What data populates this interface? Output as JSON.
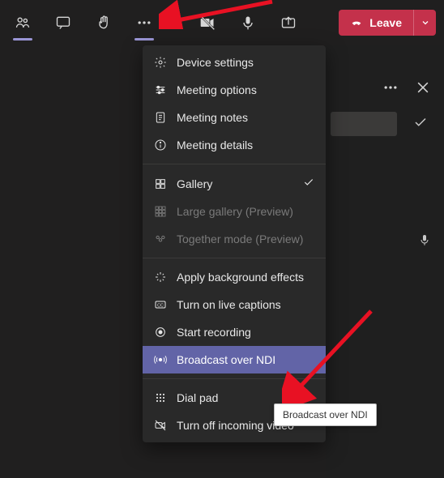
{
  "toolbar": {
    "leave_label": "Leave"
  },
  "menu": {
    "device_settings": "Device settings",
    "meeting_options": "Meeting options",
    "meeting_notes": "Meeting notes",
    "meeting_details": "Meeting details",
    "gallery": "Gallery",
    "large_gallery": "Large gallery (Preview)",
    "together_mode": "Together mode (Preview)",
    "apply_bg": "Apply background effects",
    "live_captions": "Turn on live captions",
    "start_recording": "Start recording",
    "broadcast_ndi": "Broadcast over NDI",
    "dial_pad": "Dial pad",
    "turn_off_incoming": "Turn off incoming video"
  },
  "tooltip": {
    "text": "Broadcast over NDI"
  }
}
